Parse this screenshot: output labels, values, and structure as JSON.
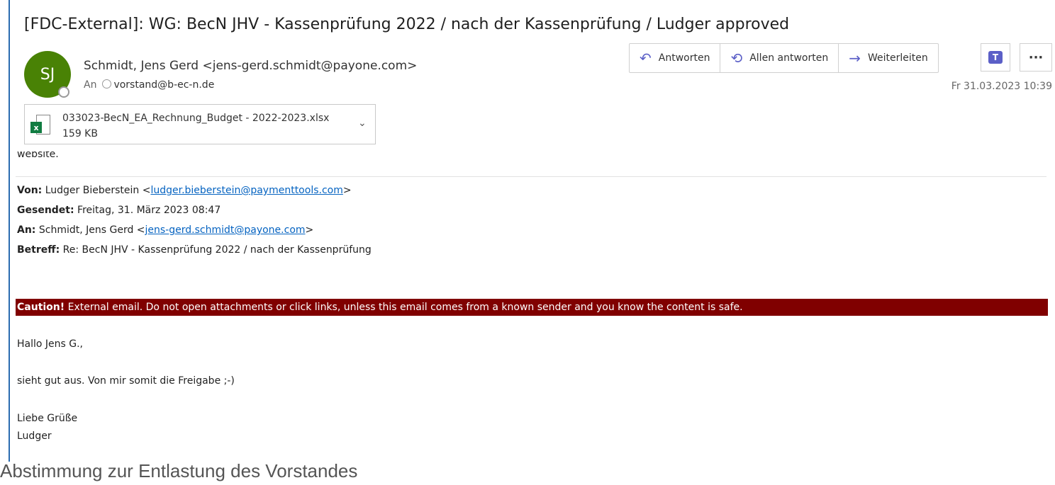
{
  "email": {
    "subject": "[FDC-External]: WG: BecN JHV - Kassenprüfung 2022 / nach der Kassenprüfung / Ludger approved",
    "avatar_initials": "SJ",
    "sender": "Schmidt, Jens Gerd <jens-gerd.schmidt@payone.com>",
    "to_label": "An",
    "to_address": "vorstand@b-ec-n.de",
    "date": "Fr 31.03.2023 10:39",
    "actions": {
      "reply": "Antworten",
      "reply_all": "Allen antworten",
      "forward": "Weiterleiten"
    },
    "attachment": {
      "name": "033023-BecN_EA_Rechnung_Budget - 2022-2023.xlsx",
      "size": "159 KB"
    }
  },
  "body": {
    "cut_off_text": "website.",
    "quoted_header": {
      "from_label": "Von:",
      "from_name": "Ludger Bieberstein <",
      "from_email": "ludger.bieberstein@paymenttools.com",
      "from_end": ">",
      "sent_label": "Gesendet:",
      "sent_value": "Freitag, 31. März 2023 08:47",
      "to_label": "An:",
      "to_name": "Schmidt, Jens Gerd <",
      "to_email": "jens-gerd.schmidt@payone.com",
      "to_end": ">",
      "subject_label": "Betreff:",
      "subject_value": "Re: BecN JHV - Kassenprüfung 2022 / nach der Kassenprüfung"
    },
    "caution_label": "Caution!",
    "caution_text": "External email. Do not open attachments or click links, unless this email comes from a known sender and you know the content is safe.",
    "greeting": "Hallo Jens G.,",
    "message": "sieht gut aus. Von mir somit die Freigabe ;-)",
    "closing": "Liebe Grüße",
    "signature": "Ludger"
  },
  "caption": "Abstimmung zur Entlastung des Vorstandes",
  "colors": {
    "avatar": "#498205",
    "caution_bg": "#800000",
    "link": "#0563c1",
    "action_icon": "#5b5fc7"
  }
}
